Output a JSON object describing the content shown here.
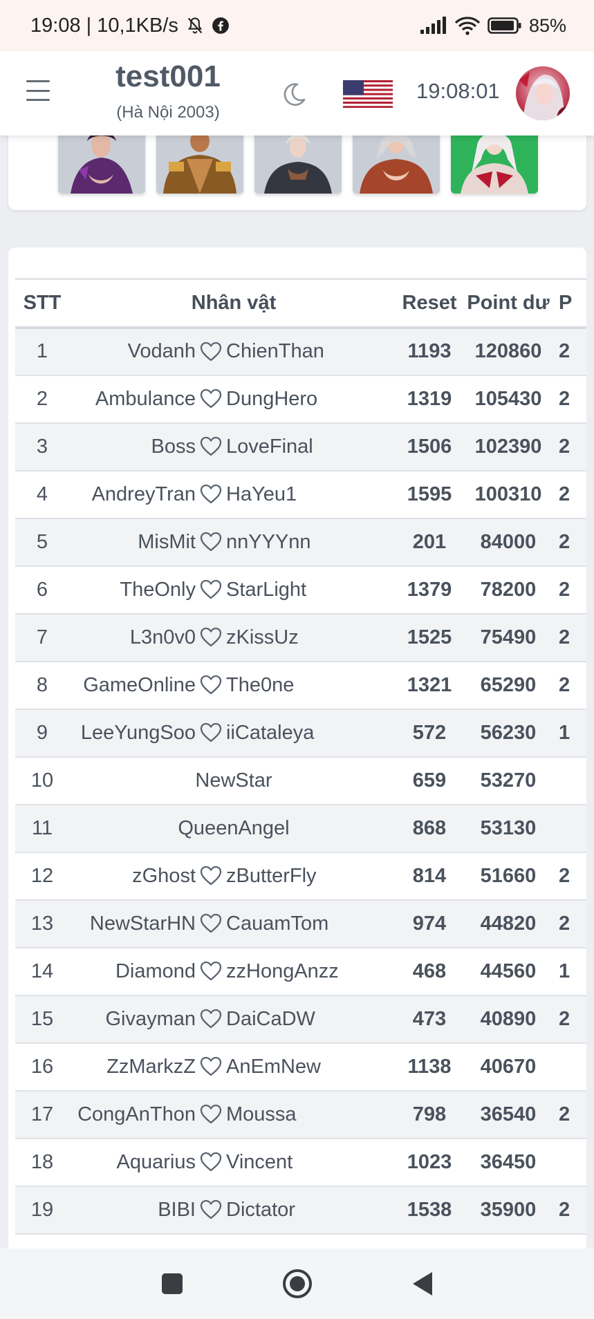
{
  "status_bar": {
    "time_speed": "19:08 | 10,1KB/s",
    "battery_pct": "85%",
    "icons": [
      "bell-off-icon",
      "facebook-icon",
      "signal-icon",
      "wifi-icon",
      "battery-icon"
    ]
  },
  "header": {
    "title": "test001",
    "subtitle": "(Hà Nội 2003)",
    "clock": "19:08:01",
    "icons": [
      "menu-icon",
      "moon-icon",
      "us-flag-icon",
      "user-avatar"
    ]
  },
  "characters": {
    "count": 5,
    "selected_index": 4
  },
  "table": {
    "headers": [
      "STT",
      "Nhân vật",
      "Reset",
      "Point dư",
      "P"
    ],
    "rows": [
      {
        "stt": "1",
        "name": "Vodanh",
        "partner": "ChienThan",
        "reset": "1193",
        "point": "120860",
        "p": "2"
      },
      {
        "stt": "2",
        "name": "Ambulance",
        "partner": "DungHero",
        "reset": "1319",
        "point": "105430",
        "p": "2"
      },
      {
        "stt": "3",
        "name": "Boss",
        "partner": "LoveFinal",
        "reset": "1506",
        "point": "102390",
        "p": "2"
      },
      {
        "stt": "4",
        "name": "AndreyTran",
        "partner": "HaYeu1",
        "reset": "1595",
        "point": "100310",
        "p": "2"
      },
      {
        "stt": "5",
        "name": "MisMit",
        "partner": "nnYYYnn",
        "reset": "201",
        "point": "84000",
        "p": "2"
      },
      {
        "stt": "6",
        "name": "TheOnly",
        "partner": "StarLight",
        "reset": "1379",
        "point": "78200",
        "p": "2"
      },
      {
        "stt": "7",
        "name": "L3n0v0",
        "partner": "zKissUz",
        "reset": "1525",
        "point": "75490",
        "p": "2"
      },
      {
        "stt": "8",
        "name": "GameOnline",
        "partner": "The0ne",
        "reset": "1321",
        "point": "65290",
        "p": "2"
      },
      {
        "stt": "9",
        "name": "LeeYungSoo",
        "partner": "iiCataleya",
        "reset": "572",
        "point": "56230",
        "p": "1"
      },
      {
        "stt": "10",
        "name": "NewStar",
        "partner": "",
        "reset": "659",
        "point": "53270",
        "p": ""
      },
      {
        "stt": "11",
        "name": "QueenAngel",
        "partner": "",
        "reset": "868",
        "point": "53130",
        "p": ""
      },
      {
        "stt": "12",
        "name": "zGhost",
        "partner": "zButterFly",
        "reset": "814",
        "point": "51660",
        "p": "2"
      },
      {
        "stt": "13",
        "name": "NewStarHN",
        "partner": "CauamTom",
        "reset": "974",
        "point": "44820",
        "p": "2"
      },
      {
        "stt": "14",
        "name": "Diamond",
        "partner": "zzHongAnzz",
        "reset": "468",
        "point": "44560",
        "p": "1"
      },
      {
        "stt": "15",
        "name": "Givayman",
        "partner": "DaiCaDW",
        "reset": "473",
        "point": "40890",
        "p": "2"
      },
      {
        "stt": "16",
        "name": "ZzMarkzZ",
        "partner": "AnEmNew",
        "reset": "1138",
        "point": "40670",
        "p": ""
      },
      {
        "stt": "17",
        "name": "CongAnThon",
        "partner": "Moussa",
        "reset": "798",
        "point": "36540",
        "p": "2"
      },
      {
        "stt": "18",
        "name": "Aquarius",
        "partner": "Vincent",
        "reset": "1023",
        "point": "36450",
        "p": ""
      },
      {
        "stt": "19",
        "name": "BIBI",
        "partner": "Dictator",
        "reset": "1538",
        "point": "35900",
        "p": "2"
      }
    ]
  },
  "nav_bar": {
    "buttons": [
      "recents-button",
      "home-button",
      "back-button"
    ]
  },
  "colors": {
    "status_bar_bg": "#fdf3f1",
    "page_bg": "#eceef1",
    "selected_thumb": "#2fb35a",
    "heart": "#5a6470"
  }
}
